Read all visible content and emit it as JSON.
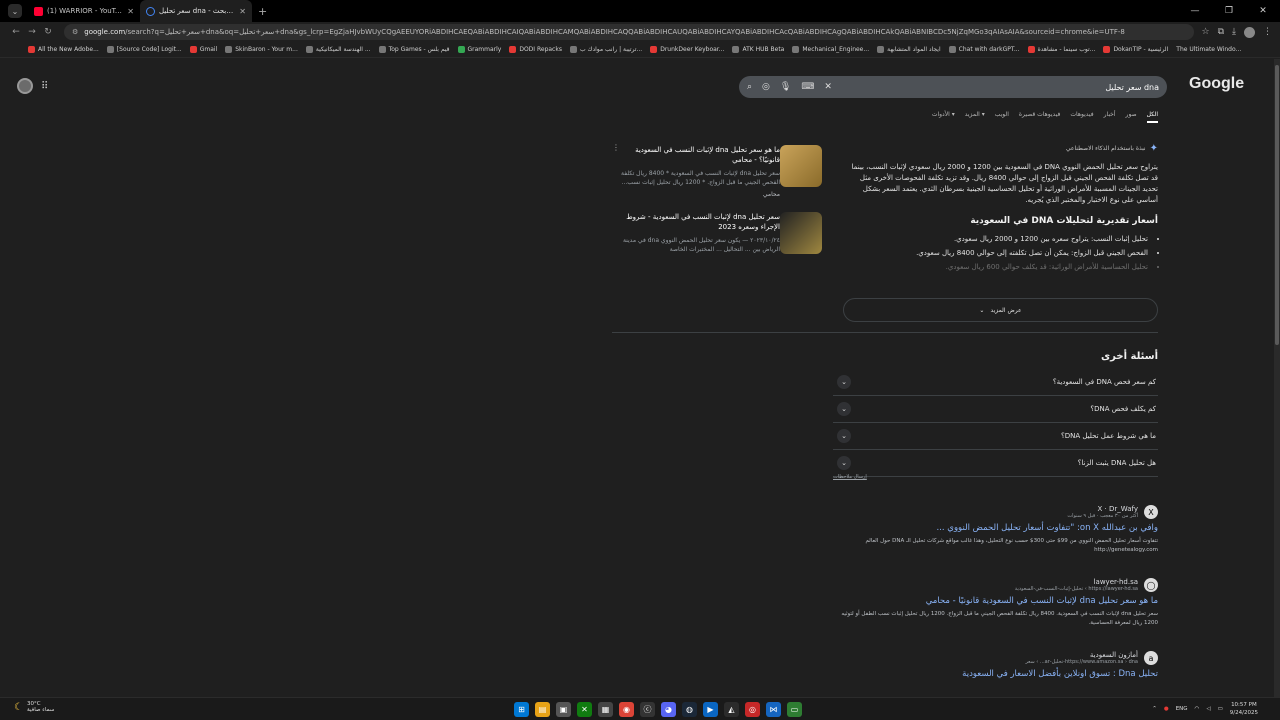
{
  "tabs": [
    {
      "title": "(1) WARRIOR - YouTube",
      "active": false
    },
    {
      "title": "سعر تحليل dna - بحث Google",
      "active": true
    }
  ],
  "toolbar": {
    "host": "google.com",
    "url_rest": "/search?q=سعر+تحليل+dna&oq=سعر+تحليل+dna&gs_lcrp=EgZjaHJvbWUyCQgAEEUYORiABDIHCAEQABiABDIHCAIQABiABDIHCAMQABiABDIHCAQQABiABDIHCAUQABiABDIHCAYQABiABDIHCAcQABiABDIHCAgQABiABDIHCAkQABiABNIBCDc5NjZqMGo3qAIAsAIA&sourceid=chrome&ie=UTF-8"
  },
  "bookmarks": [
    "All the New Adobe...",
    "[Source Code] Logit...",
    "Gmail",
    "SkinBaron - Your m...",
    "الهندسة الميكانيكية ...",
    "Top Games - قيم بلس",
    "Grammarly",
    "DODI Repacks",
    "ترتيبة | رانب موادك ب...",
    "DrunkDeer Keyboar...",
    "ATK HUB Beta",
    "Mechanical_Enginee...",
    "ايجاد المواد المتشابهة",
    "Chat with darkGPT...",
    "توب سينما - مشاهدة...",
    "DokanTIP - الرئيسية",
    "The Ultimate Windo..."
  ],
  "search": {
    "query": "سعر تحليل dna",
    "logo": "Google"
  },
  "result_tabs": [
    "الكل",
    "صور",
    "أخبار",
    "فيديوهات",
    "فيديوهات قصيرة",
    "الويب",
    "المزيد ▾",
    "الأدوات ▾"
  ],
  "ai_overview": {
    "label": "نبذة باستخدام الذكاء الاصطناعي",
    "body": "يتراوح سعر تحليل الحمض النووي DNA في السعودية بين 1200 و 2000 ريال سعودي لإثبات النسب، بينما قد تصل تكلفة الفحص الجيني قبل الزواج إلى حوالي 8400 ريال. وقد تزيد تكلفة الفحوصات الأخرى مثل تحديد الجينات المسببة للأمراض الوراثية أو تحليل الحساسية الجينية بسرطان الثدي. يعتمد السعر بشكل أساسي على نوع الاختبار والمختبر الذي يُجريه.",
    "heading": "أسعار تقديرية لتحليلات DNA في السعودية",
    "bullets": [
      "تحليل إثبات النسب: يتراوح سعره بين 1200 و 2000 ريال سعودي.",
      "الفحص الجيني قبل الزواج: يمكن أن تصل تكلفته إلى حوالي 8400 ريال سعودي.",
      "تحليل الحساسية للأمراض الوراثية: قد يكلف حوالي 600 ريال سعودي."
    ],
    "show_more": "عرض المزيد"
  },
  "side_cards": [
    {
      "title": "ما هو سعر تحليل dna لإثبات النسب في السعودية قانونيًا؟ - محامي",
      "snippet": "سعر تحليل dna لإثبات النسب في السعودية * 8400 ريال تكلفة الفحص الجيني ما قبل الزواج. * 1200 ريال تحليل إثبات نسب...",
      "source": "محامي"
    },
    {
      "title": "سعر تحليل dna لإثبات النسب في السعودية - شروط الإجراء وسعره 2023",
      "snippet": "٢٠٢٣/١٠/٢٤ — يكون سعر تحليل الحمض النووي dna في مدينة الرياض بين ... التحاليل ... المختبرات الخاصة",
      "source": ""
    }
  ],
  "paa": {
    "title": "أسئلة أخرى",
    "questions": [
      "كم سعر فحص DNA في السعودية؟",
      "كم يكلف فحص DNA؟",
      "ما هي شروط عمل تحليل DNA؟",
      "هل تحليل DNA يثبت الزنا؟"
    ],
    "feedback": "إرسال ملاحظات"
  },
  "results": [
    {
      "site": "X · Dr_Wafy",
      "url": "أكثر من ٣٠ معجب · قبل ٩ سنوات",
      "title": "وافي بن عبدالله on X: \"تتفاوت أسعار تحليل الحمض النووي ...",
      "snippet": "تتفاوت أسعار تحليل الحمض النووي من 99$ حتى 300$ حسب نوع التحليل، وهذا غالب مواقع شركات تحليل الـ DNA حول العالم http://genetealogy.com",
      "logo": "X"
    },
    {
      "site": "lawyer-hd.sa",
      "url": "https://lawyer-hd.sa › تحليل-إثبات-النسب-في-السعودية",
      "title": "ما هو سعر تحليل dna لإثبات النسب في السعودية قانونيًا - محامي",
      "snippet": "سعر تحليل dna لإثبات النسب في السعودية. 8400 ريال تكلفة الفحص الجيني ما قبل الزواج. 1200 ريال تحليل إثبات نسب الطفل أو لتوثيه 1200 ريال لمعرفة الحساسية.",
      "logo": "◯"
    },
    {
      "site": "أمازون السعودية",
      "url": "https://www.amazon.sa › dna-تحليل-ar... › سعر",
      "title": "تحليل Dna : تسوق اونلاين بأفضل الاسعار في السعودية",
      "snippet": "",
      "logo": "a"
    }
  ],
  "taskbar": {
    "temp": "30°C",
    "weather": "سماء صافية",
    "lang": "ENG",
    "time": "10:57 PM",
    "date": "9/24/2025"
  }
}
